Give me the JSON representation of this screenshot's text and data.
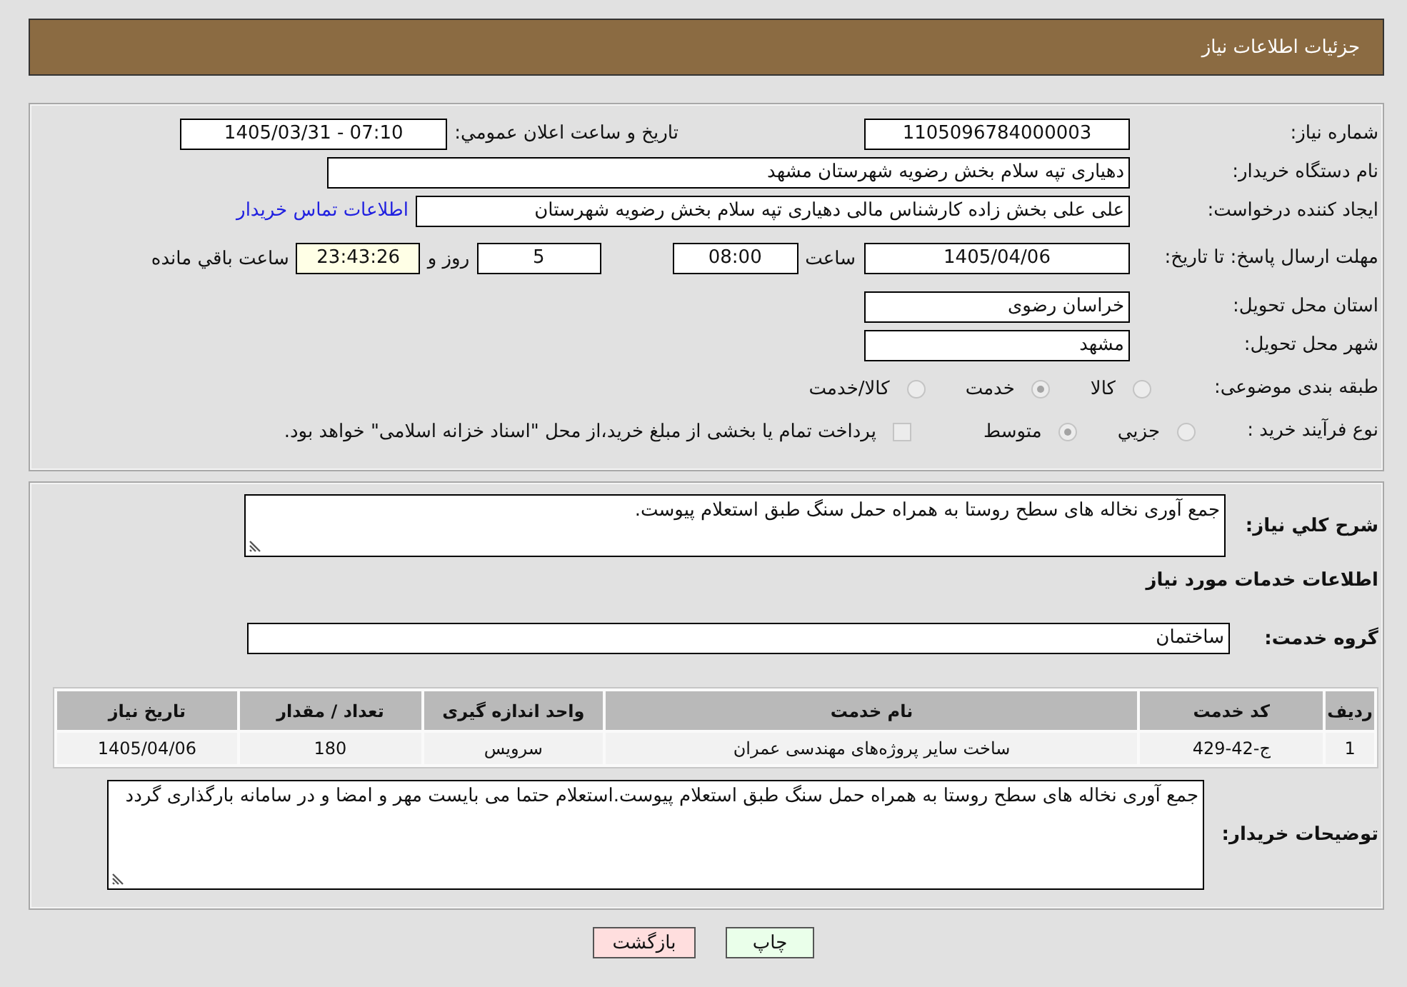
{
  "header": {
    "title": "جزئیات اطلاعات نیاز"
  },
  "details": {
    "need_number": {
      "label": "شماره نیاز:",
      "value": "1105096784000003"
    },
    "announce": {
      "label": "تاريخ و ساعت اعلان عمومي:",
      "value": "1405/03/31 - 07:10"
    },
    "buyer_org": {
      "label": "نام دستگاه خریدار:",
      "value": "دهیاری تپه سلام بخش رضویه شهرستان مشهد"
    },
    "requester": {
      "label": "ایجاد کننده درخواست:",
      "value": "علی علی بخش زاده کارشناس مالی دهیاری تپه سلام بخش رضویه شهرستان",
      "link": "اطلاعات تماس خریدار"
    },
    "deadline": {
      "label": "مهلت ارسال پاسخ: تا تاریخ:",
      "date": "1405/04/06",
      "time_label": "ساعت",
      "time": "08:00",
      "days": "5",
      "days_label": "روز و",
      "remaining": "23:43:26",
      "remaining_label": "ساعت باقي مانده"
    },
    "province": {
      "label": "استان محل تحویل:",
      "value": "خراسان رضوی"
    },
    "city": {
      "label": "شهر محل تحویل:",
      "value": "مشهد"
    },
    "category": {
      "label": "طبقه بندی موضوعی:",
      "options": [
        {
          "label": "کالا",
          "selected": false,
          "disabled": true
        },
        {
          "label": "خدمت",
          "selected": true,
          "disabled": true
        },
        {
          "label": "کالا/خدمت",
          "selected": false,
          "disabled": true
        }
      ]
    },
    "purchase_type": {
      "label": "نوع فرآیند خرید :",
      "options": [
        {
          "label": "جزيي",
          "selected": false,
          "disabled": true
        },
        {
          "label": "متوسط",
          "selected": true,
          "disabled": true
        }
      ],
      "treasury": {
        "label": "پرداخت تمام یا بخشی از مبلغ خرید،از محل \"اسناد خزانه اسلامی\" خواهد بود.",
        "checked": false,
        "disabled": true
      }
    }
  },
  "description": {
    "label": "شرح کلي نياز:",
    "value": "جمع آوری نخاله های سطح روستا به همراه حمل سنگ طبق استعلام پیوست."
  },
  "services": {
    "title": "اطلاعات خدمات مورد نیاز",
    "group": {
      "label": "گروه خدمت:",
      "value": "ساختمان"
    },
    "table": {
      "columns": [
        "ردیف",
        "کد خدمت",
        "نام خدمت",
        "واحد اندازه گیری",
        "تعداد / مقدار",
        "تاریخ نیاز"
      ],
      "rows": [
        [
          "1",
          "ج-42-429",
          "ساخت سایر پروژه‌های مهندسی عمران",
          "سرویس",
          "180",
          "1405/04/06"
        ]
      ]
    }
  },
  "buyer_notes": {
    "label": "توضیحات خریدار:",
    "value": "جمع آوری نخاله های سطح روستا به همراه حمل سنگ طبق استعلام پیوست.استعلام حتما می بایست مهر و امضا و در سامانه بارگذاری گردد"
  },
  "buttons": [
    {
      "label": "چاپ",
      "kind": "print"
    },
    {
      "label": "بازگشت",
      "kind": "back"
    }
  ]
}
